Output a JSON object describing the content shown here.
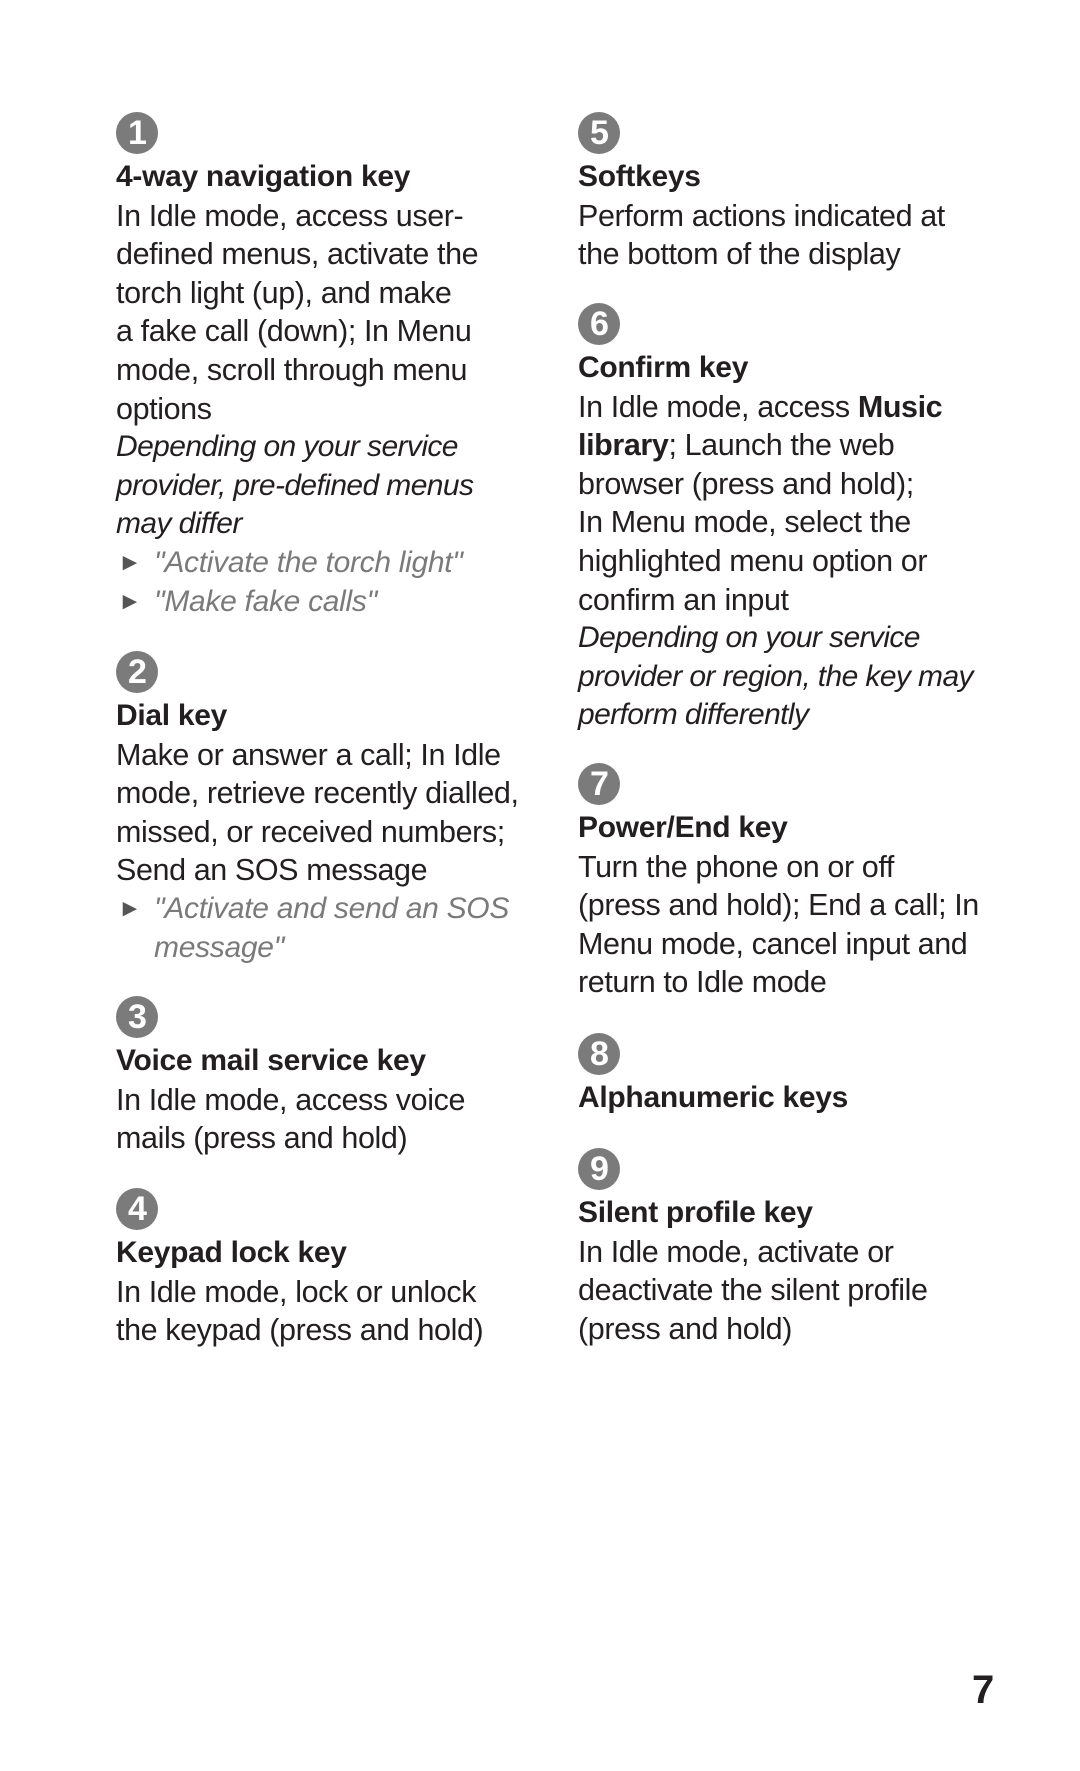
{
  "page_number": "7",
  "colors": {
    "text": "#231f20",
    "badge": "#7b7b7b",
    "link": "#7a7a7a"
  },
  "items": [
    {
      "number": "1",
      "title": "4-way navigation key",
      "lines": [
        "In Idle mode, access user-",
        "defined menus, activate the",
        "torch light (up), and make",
        "a fake call (down); In Menu",
        "mode, scroll through menu",
        "options"
      ],
      "notes": [
        "Depending on your service",
        "provider, pre-defined menus",
        "may differ"
      ],
      "links": [
        {
          "icon": "arrow-right-icon",
          "arrow": "►",
          "lines": [
            "\"Activate the torch light\""
          ]
        },
        {
          "icon": "arrow-right-icon",
          "arrow": "►",
          "lines": [
            "\"Make fake calls\""
          ]
        }
      ]
    },
    {
      "number": "2",
      "title": "Dial key",
      "lines": [
        "Make or answer a call; In Idle",
        "mode, retrieve recently dialled,",
        "missed, or received numbers;",
        "Send an SOS message"
      ],
      "links": [
        {
          "icon": "arrow-right-icon",
          "arrow": "►",
          "lines": [
            "\"Activate and send an SOS",
            "message\""
          ]
        }
      ]
    },
    {
      "number": "3",
      "title": "Voice mail service key",
      "lines": [
        "In Idle mode, access voice",
        "mails (press and hold)"
      ]
    },
    {
      "number": "4",
      "title": "Keypad lock key",
      "lines": [
        "In Idle mode, lock or unlock",
        "the keypad (press and hold)"
      ]
    },
    {
      "number": "5",
      "title": "Softkeys",
      "lines": [
        "Perform actions indicated at",
        "the bottom of the display"
      ]
    },
    {
      "number": "6",
      "title": "Confirm key",
      "line1_pre": "In Idle mode, access ",
      "line1_bold": "Music",
      "line2_bold": "library",
      "line2_post": "; Launch the web",
      "lines": [
        "browser (press and hold);",
        "In Menu mode, select the",
        "highlighted menu option or",
        "confirm an input"
      ],
      "notes": [
        "Depending on your service",
        "provider or region, the key may",
        "perform differently"
      ]
    },
    {
      "number": "7",
      "title": "Power/End key",
      "lines": [
        "Turn the phone on or off",
        "(press and hold); End a call; In",
        "Menu mode, cancel input and",
        "return to Idle mode"
      ]
    },
    {
      "number": "8",
      "title": "Alphanumeric keys"
    },
    {
      "number": "9",
      "title": "Silent profile key",
      "lines": [
        "In Idle mode, activate or",
        "deactivate the silent profile",
        "(press and hold)"
      ]
    }
  ]
}
